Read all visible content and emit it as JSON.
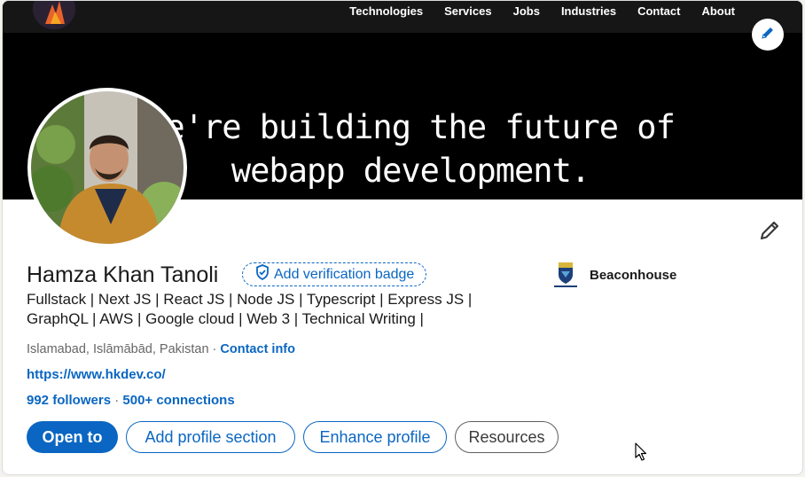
{
  "nav": {
    "links": [
      "Technologies",
      "Services",
      "Jobs",
      "Industries",
      "Contact",
      "About"
    ]
  },
  "banner": {
    "line1": "We're building the future of",
    "line2": "webapp development."
  },
  "profile": {
    "name": "Hamza Khan Tanoli",
    "verify_label": "Add verification badge",
    "headline_line1": "Fullstack | Next JS | React JS | Node JS | Typescript | Express JS |",
    "headline_line2": "GraphQL | AWS | Google cloud | Web 3 | Technical Writing |",
    "location": "Islamabad, Islāmābād, Pakistan",
    "location_sep": " · ",
    "contact_label": "Contact info",
    "website": "https://www.hkdev.co/",
    "followers": "992 followers",
    "stats_sep": " · ",
    "connections": "500+ connections"
  },
  "education": {
    "name": "Beaconhouse"
  },
  "actions": {
    "open_to": "Open to",
    "add_section": "Add profile section",
    "enhance": "Enhance profile",
    "resources": "Resources"
  },
  "colors": {
    "accent": "#0a66c2",
    "banner_bg": "#000000",
    "text": "#1a1a1a",
    "muted": "#666666"
  },
  "icons": [
    "pencil-icon",
    "shield-check-icon",
    "school-logo",
    "mouse-cursor-icon"
  ]
}
